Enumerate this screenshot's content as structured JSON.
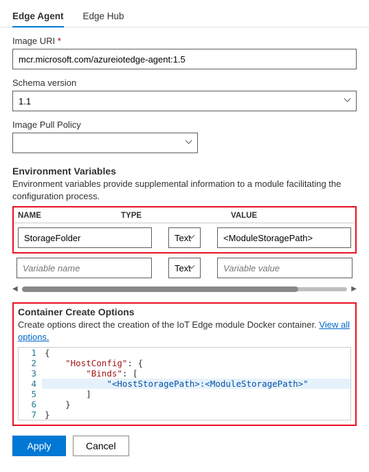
{
  "tabs": {
    "edge_agent": "Edge Agent",
    "edge_hub": "Edge Hub"
  },
  "image_uri": {
    "label": "Image URI",
    "value": "mcr.microsoft.com/azureiotedge-agent:1.5"
  },
  "schema_version": {
    "label": "Schema version",
    "value": "1.1"
  },
  "image_pull_policy": {
    "label": "Image Pull Policy",
    "value": ""
  },
  "env": {
    "title": "Environment Variables",
    "desc": "Environment variables provide supplemental information to a module facilitating the configuration process.",
    "headers": {
      "name": "NAME",
      "type": "TYPE",
      "value": "VALUE"
    },
    "rows": [
      {
        "name": "StorageFolder",
        "type": "Text",
        "value": "<ModuleStoragePath>"
      }
    ],
    "placeholder": {
      "name": "Variable name",
      "type": "Text",
      "value": "Variable value"
    }
  },
  "cco": {
    "title": "Container Create Options",
    "desc": "Create options direct the creation of the IoT Edge module Docker container. ",
    "link": "View all options.",
    "code": {
      "lines": [
        {
          "n": 1,
          "pre": "",
          "raw": "{"
        },
        {
          "n": 2,
          "pre": "    ",
          "key": "HostConfig",
          "after": ": {"
        },
        {
          "n": 3,
          "pre": "        ",
          "key": "Binds",
          "after": ": ["
        },
        {
          "n": 4,
          "pre": "            ",
          "str": "<HostStoragePath>:<ModuleStoragePath>"
        },
        {
          "n": 5,
          "pre": "        ",
          "raw": "]"
        },
        {
          "n": 6,
          "pre": "    ",
          "raw": "}"
        },
        {
          "n": 7,
          "pre": "",
          "raw": "}"
        }
      ]
    }
  },
  "buttons": {
    "apply": "Apply",
    "cancel": "Cancel"
  }
}
